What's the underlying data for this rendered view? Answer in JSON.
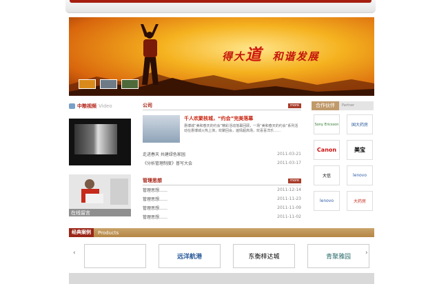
{
  "banner": {
    "slogan_part1": "得大",
    "slogan_big": "道",
    "slogan_part2": "和谐发展"
  },
  "video": {
    "title": "中粮视频",
    "title_en": "Video",
    "caption": "在线留言"
  },
  "company_news": {
    "title": "公司",
    "more": "more",
    "feature_title": "千人欢聚核城，“约会”完美落幕",
    "feature_desc": "惠博城“美和春天的约会”精彩活动落幕回顾，一场“美和春天的约会”系列活动在惠博城火热上演，欢聚回会，遍情超高场，欢喜喜洋乐……",
    "items": [
      {
        "title": "走进春天 共建绿色家园",
        "date": "2011-03-21"
      },
      {
        "title": "《分析管理制度》普写大会",
        "date": "2011-03-17"
      }
    ]
  },
  "management": {
    "title": "管理思想",
    "more": "more",
    "items": [
      {
        "title": "管理思想……",
        "date": "2011-12-14"
      },
      {
        "title": "管理思想……",
        "date": "2011-11-23"
      },
      {
        "title": "管理思想……",
        "date": "2011-11-09"
      },
      {
        "title": "管理思想……",
        "date": "2011-11-02"
      }
    ]
  },
  "partners": {
    "title": "合作伙伴",
    "subtitle": "Partner",
    "logos": [
      "Sony Ericsson",
      "国大药房",
      "Canon",
      "美宝",
      "大信",
      "lenovo",
      "lenovo",
      "大药房"
    ]
  },
  "classic": {
    "title": "经典案例",
    "subtitle": "Products"
  },
  "carousel": {
    "prev": "‹",
    "next": "›",
    "logos": [
      "",
      "远洋航港",
      "东衡梓达城",
      "青聚雅园"
    ]
  },
  "colors": {
    "brand_red": "#a51e10",
    "gold": "#c09a6b"
  }
}
